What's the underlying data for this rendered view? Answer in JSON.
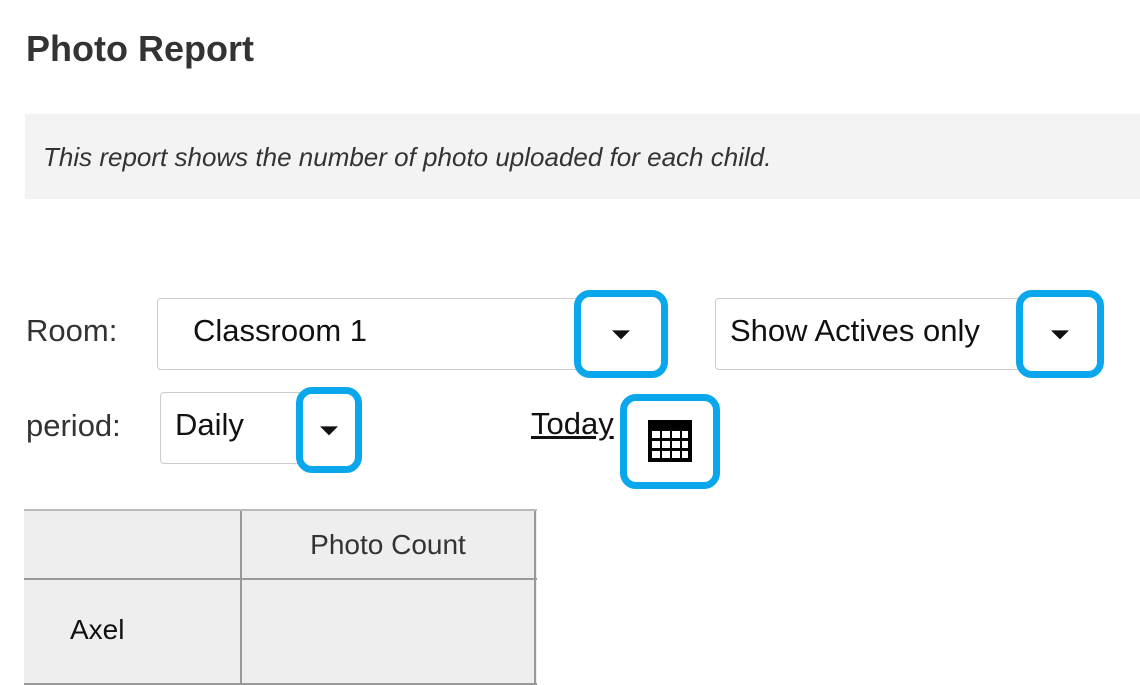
{
  "page": {
    "title": "Photo Report",
    "description": "This report shows the number of photo uploaded for each child."
  },
  "filters": {
    "room_label": "Room:",
    "room_value": "Classroom 1",
    "status_value": "Show Actives only",
    "period_label": "period:",
    "period_value": "Daily",
    "date_link": "Today"
  },
  "icons": {
    "dropdown": "chevron-down-icon",
    "calendar": "calendar-icon"
  },
  "table": {
    "columns": [
      "",
      "Photo Count"
    ],
    "rows": [
      {
        "name": "Axel",
        "photo_count": ""
      }
    ]
  },
  "colors": {
    "highlight": "#0aa7ec",
    "info_background": "#f3f3f3",
    "table_background": "#eeeeee"
  }
}
